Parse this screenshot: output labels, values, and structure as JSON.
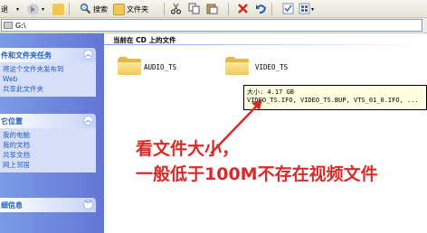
{
  "toolbar": {
    "back_label": "退",
    "search_label": "搜索",
    "folders_label": "文件夹"
  },
  "address": {
    "value": "G:\\"
  },
  "sidebar": {
    "panels": [
      {
        "title": "件和文件夹任务",
        "links": [
          "将这个文件夹发布到",
          "Web",
          "共享此文件夹"
        ]
      },
      {
        "title": "它位置",
        "links": [
          "我的电脑",
          "我的文档",
          "共享文档",
          "网上邻居"
        ]
      },
      {
        "title": "细信息",
        "links": []
      }
    ]
  },
  "main": {
    "group_title": "当前在 CD 上的文件",
    "folders": [
      {
        "name": "AUDIO_TS"
      },
      {
        "name": "VIDEO_TS"
      }
    ],
    "tooltip": {
      "size_line": "大小: 4.17 GB",
      "files_line": "VIDEO_TS.IFO, VIDEO_TS.BUP, VTS_01_0.IFO, ..."
    }
  },
  "annotation": {
    "line1": "看文件大小，",
    "line2": "一般低于100M不存在视频文件",
    "color": "#d92a2a"
  }
}
